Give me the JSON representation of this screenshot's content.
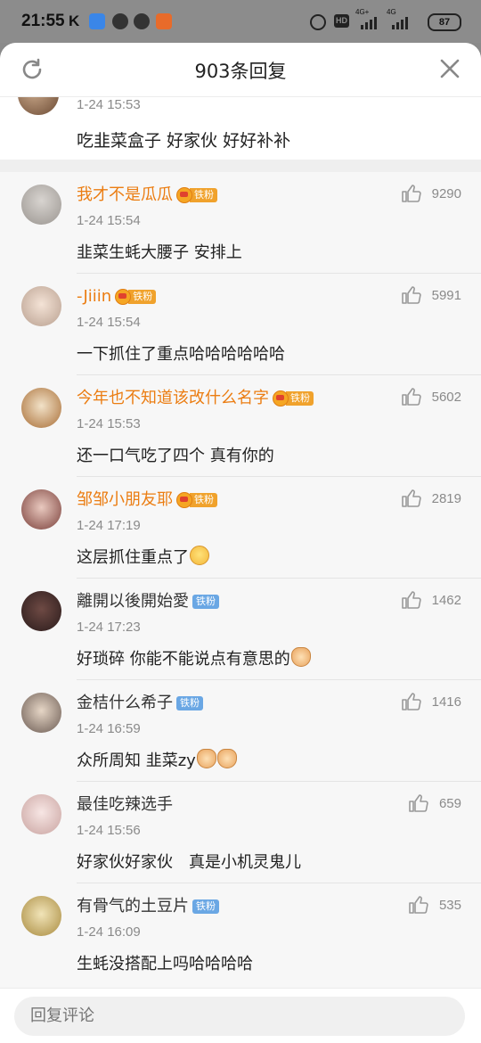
{
  "status_bar": {
    "time": "21:55",
    "k_glyph": "K",
    "hd": "HD",
    "signal1": "4G+",
    "signal2": "4G",
    "battery": "87"
  },
  "sheet": {
    "title": "903条回复",
    "refresh_icon": "refresh-icon",
    "close_icon": "close-icon"
  },
  "root_comment": {
    "time": "1-24 15:53",
    "text": "吃韭菜盒子 好家伙 好好补补"
  },
  "replies": [
    {
      "name": "我才不是瓜瓜",
      "name_color": "#eb7d12",
      "badge": "铁粉",
      "badge_style": "gold",
      "time": "1-24 15:54",
      "text": "韭菜生蚝大腰子 安排上",
      "likes": "9290",
      "emoji": ""
    },
    {
      "name": "-Jiiin",
      "name_color": "#eb7d12",
      "badge": "铁粉",
      "badge_style": "gold",
      "time": "1-24 15:54",
      "text": "一下抓住了重点哈哈哈哈哈哈",
      "likes": "5991",
      "emoji": ""
    },
    {
      "name": "今年也不知道该改什么名字",
      "name_color": "#eb7d12",
      "badge": "铁粉",
      "badge_style": "gold",
      "time": "1-24 15:53",
      "text": "还一口气吃了四个 真有你的",
      "likes": "5602",
      "emoji": ""
    },
    {
      "name": "邹邹小朋友耶",
      "name_color": "#eb7d12",
      "badge": "铁粉",
      "badge_style": "gold",
      "time": "1-24 17:19",
      "text": "这层抓住重点了",
      "likes": "2819",
      "emoji": "smile"
    },
    {
      "name": "離開以後開始愛",
      "name_color": "#333333",
      "badge": "铁粉",
      "badge_style": "blue",
      "time": "1-24 17:23",
      "text": "好琐碎 你能不能说点有意思的",
      "likes": "1462",
      "emoji": "cat"
    },
    {
      "name": "金桔什么希子",
      "name_color": "#333333",
      "badge": "铁粉",
      "badge_style": "blue",
      "time": "1-24 16:59",
      "text": "众所周知 韭菜zy",
      "likes": "1416",
      "emoji": "cat2"
    },
    {
      "name": "最佳吃辣选手",
      "name_color": "#333333",
      "badge": "",
      "badge_style": "",
      "time": "1-24 15:56",
      "text": "好家伙好家伙　真是小机灵鬼儿",
      "likes": "659",
      "emoji": ""
    },
    {
      "name": "有骨气的土豆片",
      "name_color": "#333333",
      "badge": "铁粉",
      "badge_style": "blue",
      "time": "1-24 16:09",
      "text": "生蚝没搭配上吗哈哈哈哈",
      "likes": "535",
      "emoji": ""
    }
  ],
  "bottom_bar": {
    "placeholder": "回复评论"
  }
}
